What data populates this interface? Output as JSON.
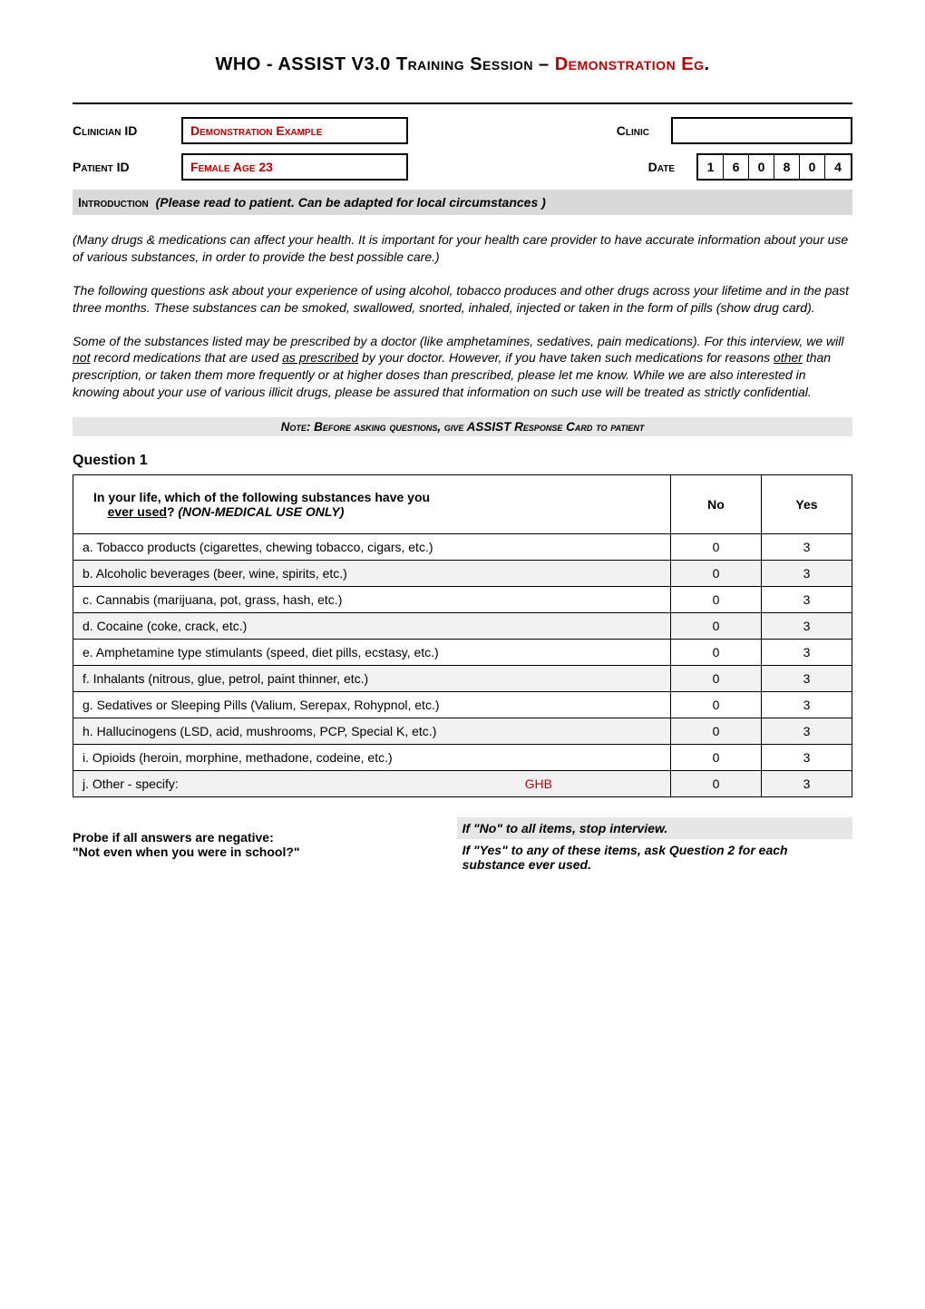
{
  "title": {
    "main": "WHO - ASSIST V3.0 Training Session – ",
    "red1": "Demonstration Eg",
    "dot": "."
  },
  "meta": {
    "clinician_label": "Clinician ID",
    "clinician_value": "Demonstration Example",
    "clinic_label": "Clinic",
    "clinic_value": "",
    "patient_label": "Patient ID",
    "patient_value": "Female Age 23",
    "date_label": "Date",
    "date_cells": [
      "1",
      "6",
      "0",
      "8",
      "0",
      "4"
    ]
  },
  "intro_band": {
    "label": "Introduction",
    "text": "(Please read to patient.  Can be adapted for local circumstances )"
  },
  "paras": {
    "p1": "(Many drugs & medications can affect your health.  It is important for your health care provider to have accurate information about your use of various substances, in order to provide the best possible care.)",
    "p2": "The following questions ask about your experience of using alcohol, tobacco produces and other drugs across your lifetime and in the past three months.  These substances can be smoked, swallowed, snorted, inhaled, injected or taken in the form of pills (show drug card).",
    "p3a": "Some of the substances listed may be prescribed by a doctor (like amphetamines, sedatives, pain medications).  For this interview, we will ",
    "p3u1": "not",
    "p3b": " record medications that are used ",
    "p3u2": "as prescribed",
    "p3c": " by your doctor.  However, if you have taken such medications for reasons ",
    "p3u3": "other",
    "p3d": " than prescription, or taken them more frequently or at higher doses than prescribed, please let me know.  While we are also interested in knowing about your use of various illicit drugs, please be assured that information on such use will be treated as strictly confidential."
  },
  "note_band": "Note: Before asking questions, give ASSIST Response Card to patient",
  "q1": {
    "heading": "Question 1",
    "header_a": "In your life, which of the following substances have you ",
    "header_u": "ever used",
    "header_b": "?  ",
    "header_em": "(NON-MEDICAL USE ONLY)",
    "col_no": "No",
    "col_yes": "Yes",
    "rows": [
      {
        "label": "a.  Tobacco products (cigarettes, chewing tobacco, cigars, etc.)",
        "no": "0",
        "yes": "3",
        "alt": false
      },
      {
        "label": "b.  Alcoholic beverages (beer, wine, spirits, etc.)",
        "no": "0",
        "yes": "3",
        "alt": true
      },
      {
        "label": "c.  Cannabis (marijuana, pot, grass, hash, etc.)",
        "no": "0",
        "yes": "3",
        "alt": false
      },
      {
        "label": "d.  Cocaine (coke, crack, etc.)",
        "no": "0",
        "yes": "3",
        "alt": true
      },
      {
        "label": "e. Amphetamine type stimulants (speed, diet pills, ecstasy, etc.)",
        "no": "0",
        "yes": "3",
        "alt": false
      },
      {
        "label": "f.  Inhalants (nitrous, glue, petrol, paint thinner, etc.)",
        "no": "0",
        "yes": "3",
        "alt": true
      },
      {
        "label": "g.  Sedatives or Sleeping Pills (Valium, Serepax, Rohypnol, etc.)",
        "no": "0",
        "yes": "3",
        "alt": false
      },
      {
        "label": "h.  Hallucinogens (LSD, acid, mushrooms, PCP, Special K, etc.)",
        "no": "0",
        "yes": "3",
        "alt": true
      },
      {
        "label": "i.  Opioids (heroin, morphine, methadone, codeine, etc.)",
        "no": "0",
        "yes": "3",
        "alt": false
      }
    ],
    "other_label": "j.  Other - specify:",
    "other_value": "GHB",
    "other_no": "0",
    "other_yes": "3"
  },
  "footer": {
    "left1": "Probe if all answers are negative:",
    "left2": "\"Not even when you were in school?\"",
    "right1": "If \"No\" to all items, stop interview.",
    "right2": "If \"Yes\" to any of these items, ask Question 2 for each substance ever used."
  }
}
